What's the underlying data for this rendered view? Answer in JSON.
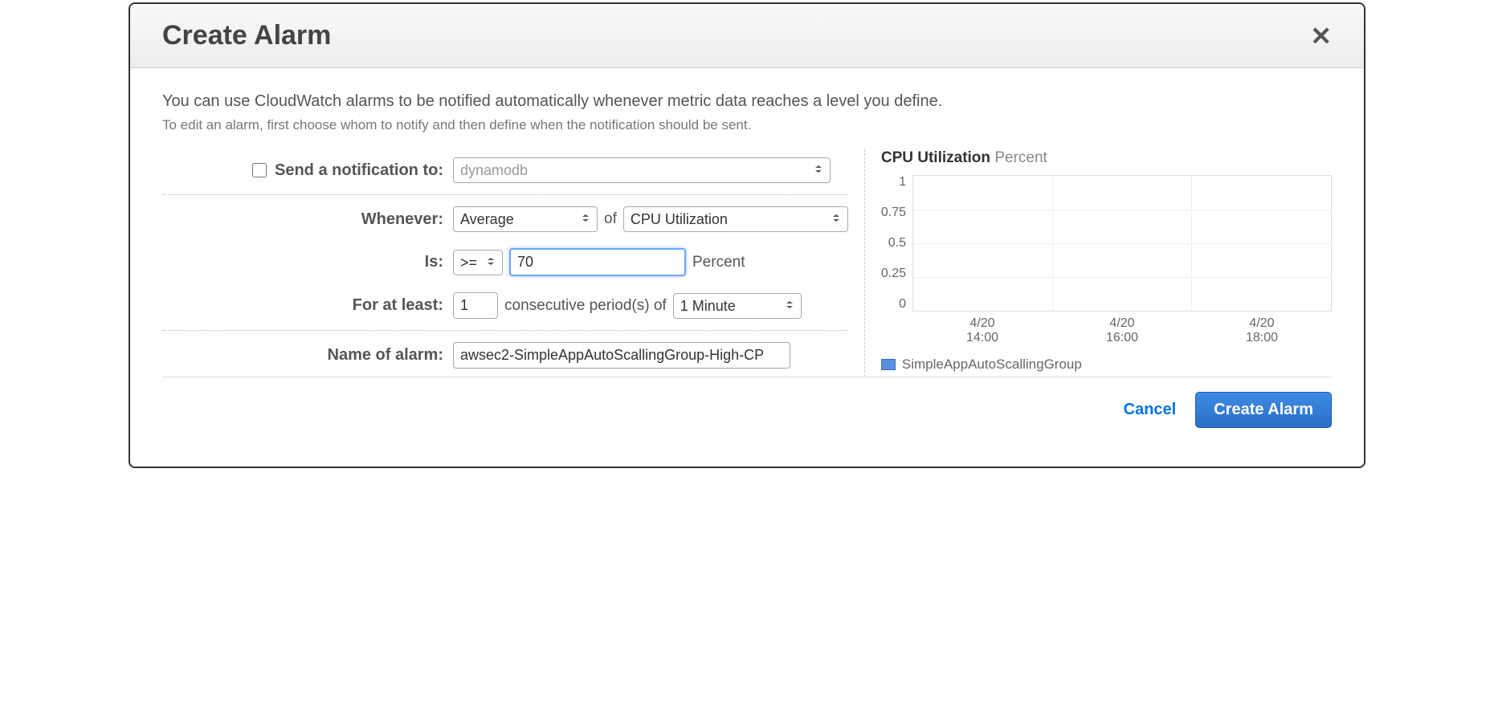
{
  "dialog": {
    "title": "Create Alarm",
    "intro": "You can use CloudWatch alarms to be notified automatically whenever metric data reaches a level you define.",
    "subintro": "To edit an alarm, first choose whom to notify and then define when the notification should be sent."
  },
  "form": {
    "notification_label": "Send a notification to:",
    "notification_value": "dynamodb",
    "whenever_label": "Whenever:",
    "stat_value": "Average",
    "of_text": "of",
    "metric_value": "CPU Utilization",
    "is_label": "Is:",
    "comparator_value": ">=",
    "threshold_value": "70",
    "unit_text": "Percent",
    "for_label": "For at least:",
    "periods_value": "1",
    "consecutive_text": "consecutive period(s) of",
    "period_value": "1 Minute",
    "name_label": "Name of alarm:",
    "name_value": "awsec2-SimpleAppAutoScallingGroup-High-CP"
  },
  "chart": {
    "title": "CPU Utilization",
    "unit": "Percent",
    "legend": "SimpleAppAutoScallingGroup",
    "y_ticks": [
      "1",
      "0.75",
      "0.5",
      "0.25",
      "0"
    ],
    "x_ticks": [
      {
        "date": "4/20",
        "time": "14:00"
      },
      {
        "date": "4/20",
        "time": "16:00"
      },
      {
        "date": "4/20",
        "time": "18:00"
      }
    ]
  },
  "footer": {
    "cancel": "Cancel",
    "create": "Create Alarm"
  },
  "chart_data": {
    "type": "line",
    "title": "CPU Utilization Percent",
    "xlabel": "",
    "ylabel": "",
    "ylim": [
      0,
      1
    ],
    "x": [
      "4/20 14:00",
      "4/20 16:00",
      "4/20 18:00"
    ],
    "series": [
      {
        "name": "SimpleAppAutoScallingGroup",
        "values": [
          null,
          null,
          null
        ]
      }
    ]
  }
}
